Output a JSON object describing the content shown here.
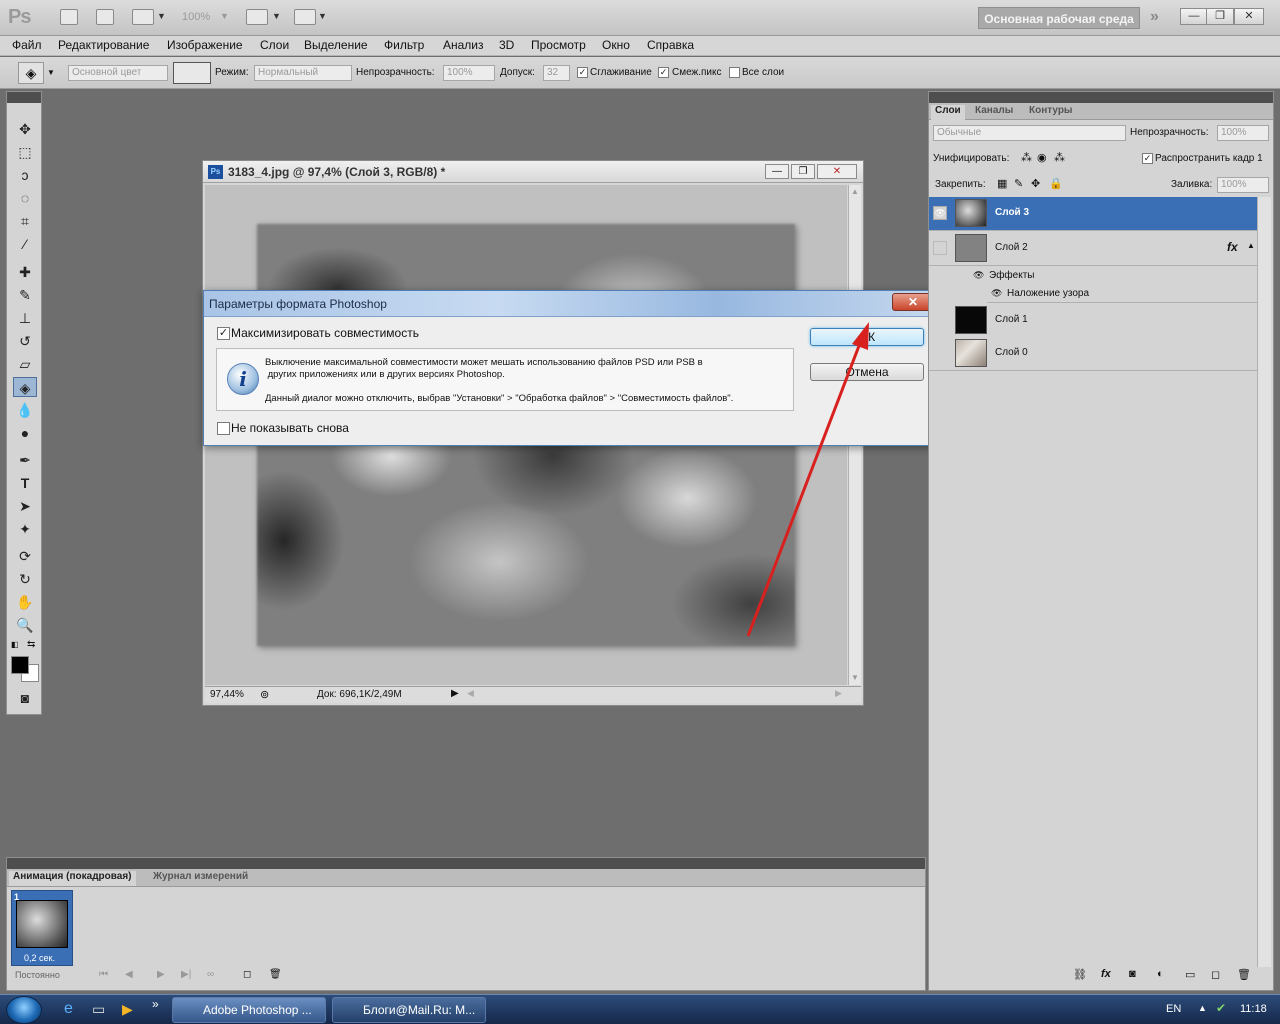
{
  "app": {
    "logo": "Ps",
    "zoom": "100%",
    "workspace_label": "Основная рабочая среда"
  },
  "menu": [
    "Файл",
    "Редактирование",
    "Изображение",
    "Слои",
    "Выделение",
    "Фильтр",
    "Анализ",
    "3D",
    "Просмотр",
    "Окно",
    "Справка"
  ],
  "options": {
    "fill_source": "Основной цвет",
    "mode_label": "Режим:",
    "mode_value": "Нормальный",
    "opacity_label": "Непрозрачность:",
    "opacity_value": "100%",
    "tolerance_label": "Допуск:",
    "tolerance_value": "32",
    "antialias_label": "Сглаживание",
    "contiguous_label": "Смеж.пикс",
    "all_layers_label": "Все слои"
  },
  "document": {
    "title": "3183_4.jpg @ 97,4% (Слой 3, RGB/8) *",
    "zoom": "97,44%",
    "doc_info": "Док: 696,1K/2,49M"
  },
  "dialog": {
    "title": "Параметры формата Photoshop",
    "maximize_label": "Максимизировать совместимость",
    "maximize_checked": true,
    "message_line1": "Выключение максимальной совместимости может мешать использованию файлов PSD или PSB в",
    "message_line2": " других приложениях или в других версиях Photoshop.",
    "message_line3": "Данный диалог можно отключить, выбрав \"Установки\" > \"Обработка файлов\" > \"Совместимость файлов\".",
    "dont_show_label": "Не показывать снова",
    "ok_label": "ОК",
    "cancel_label": "Отмена"
  },
  "layers_panel": {
    "tabs": [
      "Слои",
      "Каналы",
      "Контуры"
    ],
    "blend_mode": "Обычные",
    "opacity_label": "Непрозрачность:",
    "opacity_value": "100%",
    "unify_label": "Унифицировать:",
    "propagate_label": "Распространить кадр 1",
    "lock_label": "Закрепить:",
    "fill_label": "Заливка:",
    "fill_value": "100%",
    "layers": [
      {
        "name": "Слой 3",
        "selected": true
      },
      {
        "name": "Слой 2",
        "selected": false,
        "fx": "fx"
      },
      {
        "name": "Слой 1",
        "selected": false
      },
      {
        "name": "Слой 0",
        "selected": false
      }
    ],
    "effects_label": "Эффекты",
    "effect_name": "Наложение узора"
  },
  "animation_panel": {
    "tabs": [
      "Анимация (покадровая)",
      "Журнал измерений"
    ],
    "frame_number": "1",
    "frame_delay": "0,2 сек.",
    "loop": "Постоянно"
  },
  "taskbar": {
    "items": [
      "Adobe Photoshop ...",
      "Блоги@Mail.Ru: M..."
    ],
    "lang": "EN",
    "time": "11:18"
  },
  "colors": {
    "accent_selected": "#3a6fb5",
    "arrow": "#d8211f"
  }
}
